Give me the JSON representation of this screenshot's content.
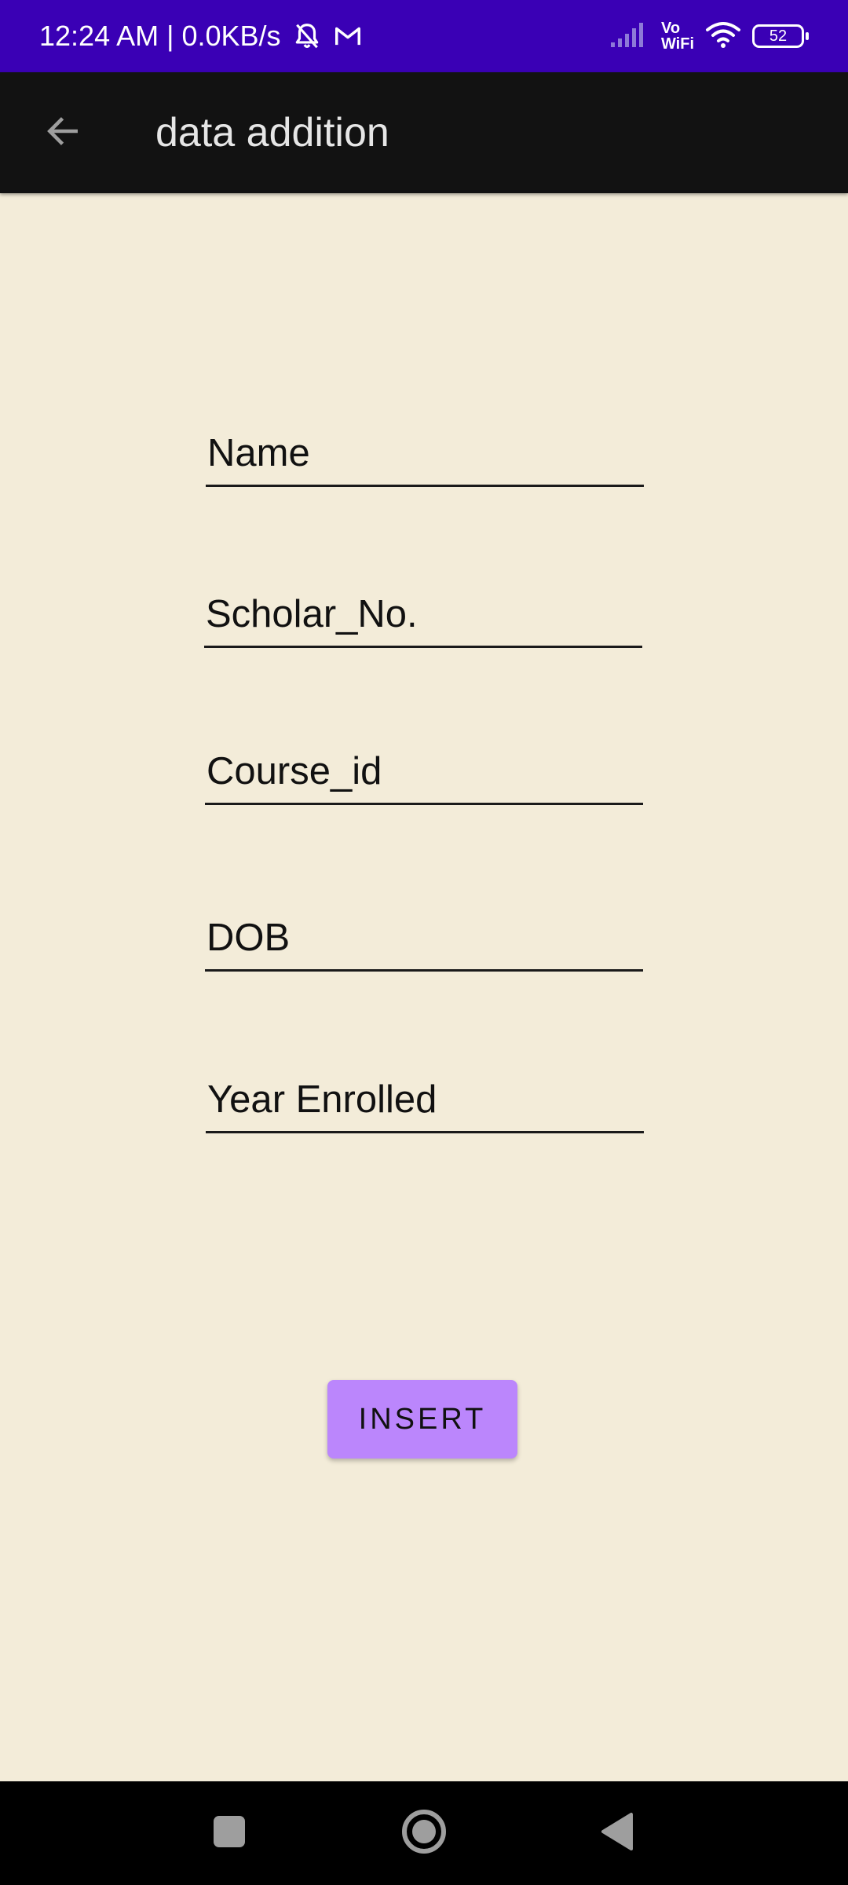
{
  "status_bar": {
    "time_speed": "12:24 AM | 0.0KB/s",
    "vowifi_top": "Vo",
    "vowifi_bottom": "WiFi",
    "battery_level": "52",
    "icons": [
      "mute-bell-icon",
      "gmail-icon",
      "signal-icon",
      "wifi-icon",
      "battery-icon"
    ]
  },
  "app_bar": {
    "title": "data addition",
    "back_icon": "arrow-left-icon"
  },
  "form": {
    "fields": [
      {
        "placeholder": "Name",
        "value": ""
      },
      {
        "placeholder": "Scholar_No.",
        "value": ""
      },
      {
        "placeholder": "Course_id",
        "value": ""
      },
      {
        "placeholder": "DOB",
        "value": ""
      },
      {
        "placeholder": "Year Enrolled",
        "value": ""
      }
    ],
    "insert_label": "INSERT"
  },
  "nav_bar": {
    "icons": [
      "recents-square-icon",
      "home-circle-icon",
      "back-triangle-icon"
    ]
  },
  "colors": {
    "status_bar": "#3A00B5",
    "app_bar": "#121212",
    "background": "#F3ECD9",
    "button": "#BB86FC",
    "nav_bar": "#000000"
  }
}
